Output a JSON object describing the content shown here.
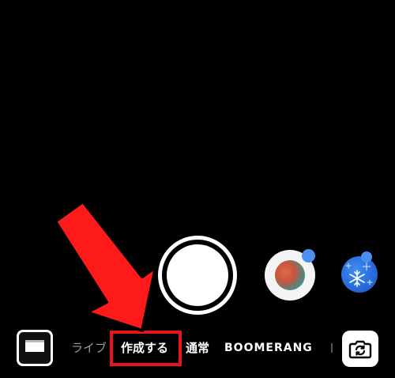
{
  "camera": {
    "modes": {
      "live": "ライブ",
      "create": "作成する",
      "normal": "通常",
      "boomerang": "BOOMERANG"
    },
    "selected_mode": "通常"
  },
  "effects": [
    {
      "icon": "color-filter-icon",
      "has_new_badge": true
    },
    {
      "icon": "snowflake-filter-icon",
      "has_new_badge": true
    }
  ],
  "colors": {
    "background": "#000000",
    "highlight": "#e8141b",
    "arrow": "#ff1a1a",
    "badge": "#4a90f0",
    "inactive_mode": "#9a9a9a"
  },
  "icons": {
    "flip": "camera-flip-icon",
    "gallery": "gallery-thumbnail",
    "annotation": "red-arrow-icon"
  }
}
